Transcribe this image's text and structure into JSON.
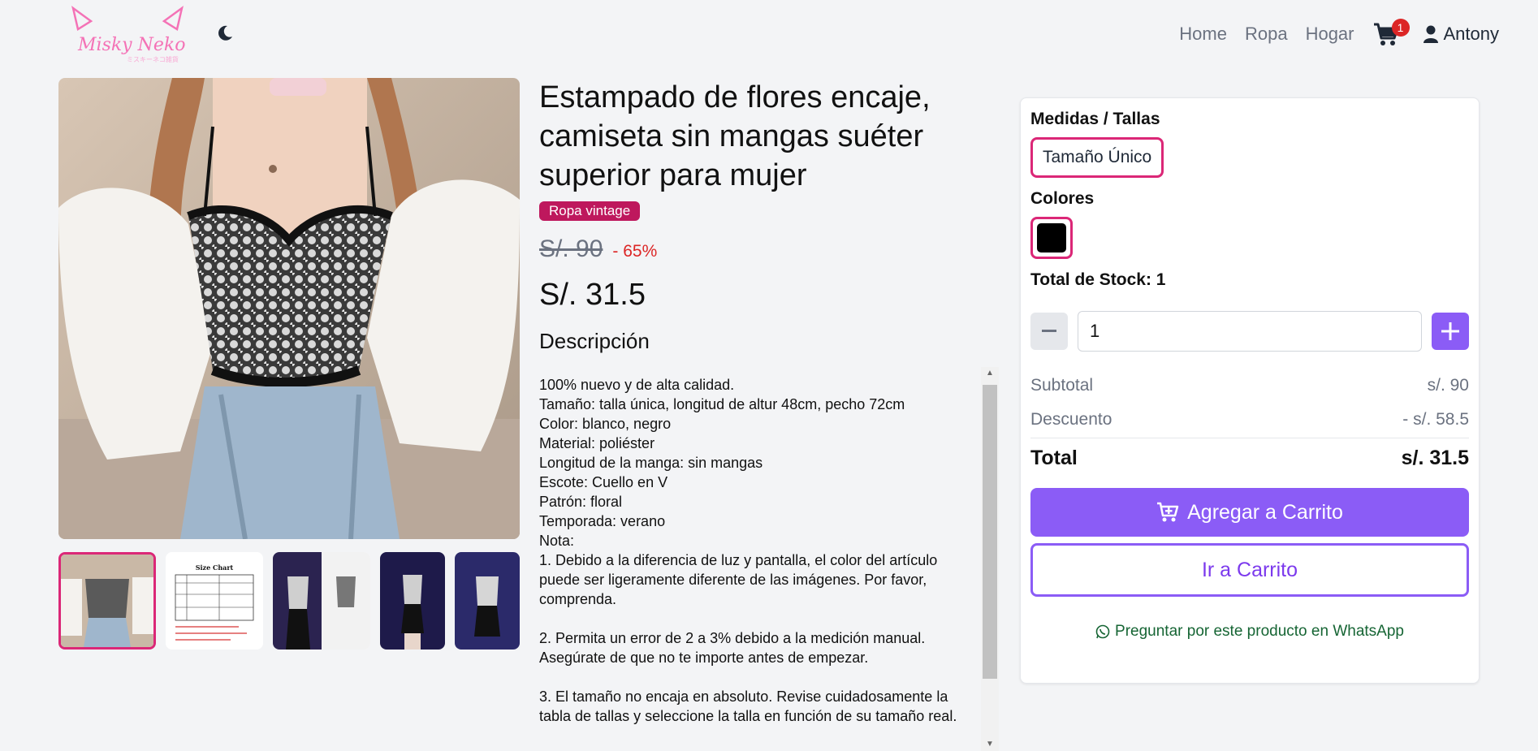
{
  "nav": {
    "logo_text": "Misky Neko",
    "links": [
      {
        "label": "Home"
      },
      {
        "label": "Ropa"
      },
      {
        "label": "Hogar"
      }
    ],
    "cart_count": "1",
    "user_name": "Antony"
  },
  "product": {
    "title": "Estampado de flores encaje, camiseta sin mangas suéter superior para mujer",
    "tag": "Ropa vintage",
    "old_price": "S/. 90",
    "discount": "- 65%",
    "price": "S/. 31.5",
    "description_title": "Descripción",
    "description": "100% nuevo y de alta calidad.\nTamaño: talla única, longitud de altur 48cm, pecho 72cm\nColor: blanco, negro\nMaterial: poliéster\nLongitud de la manga: sin mangas\nEscote: Cuello en V\nPatrón: floral\nTemporada: verano\nNota:\n1. Debido a la diferencia de luz y pantalla, el color del artículo puede ser ligeramente diferente de las imágenes. Por favor, comprenda.\n\n2. Permita un error de 2 a 3% debido a la medición manual. Asegúrate de que no te importe antes de empezar.\n\n3. El tamaño no encaja en absoluto. Revise cuidadosamente la tabla de tallas y seleccione la talla en función de su tamaño real.",
    "size_chart_title": "Size Chart"
  },
  "panel": {
    "sizes_label": "Medidas / Tallas",
    "size_value": "Tamaño Único",
    "colors_label": "Colores",
    "color_value": "#000000",
    "stock_label": "Total de Stock: 1",
    "quantity": "1",
    "subtotal_label": "Subtotal",
    "subtotal_value": "s/. 90",
    "discount_label": "Descuento",
    "discount_value": "- s/. 58.5",
    "total_label": "Total",
    "total_value": "s/. 31.5",
    "add_to_cart": "Agregar a Carrito",
    "go_to_cart": "Ir a Carrito",
    "whatsapp": "Preguntar por este producto en WhatsApp"
  },
  "colors": {
    "accent_purple": "#8b5cf6",
    "accent_pink": "#db2777",
    "tag_bg": "#be185d",
    "discount_red": "#dc2626",
    "whatsapp_green": "#166534"
  }
}
